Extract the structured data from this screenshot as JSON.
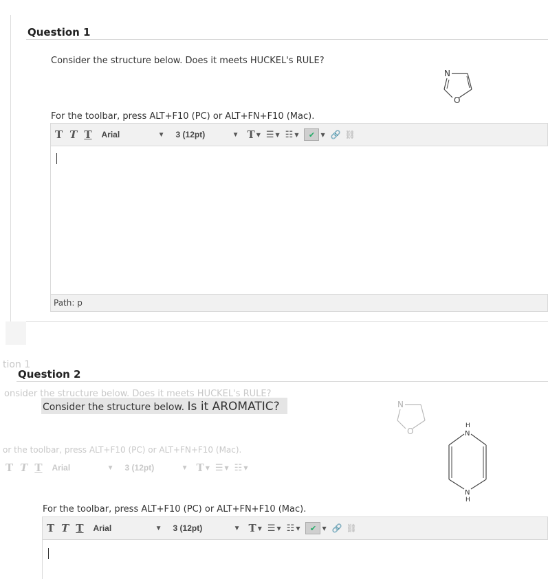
{
  "question1": {
    "title": "Question 1",
    "prompt": "Consider the structure below. Does it meets HUCKEL's RULE?",
    "toolbar_hint": "For the toolbar, press ALT+F10 (PC) or ALT+FN+F10 (Mac).",
    "toolbar": {
      "font": "Arial",
      "size": "3 (12pt)"
    },
    "path_label": "Path: p",
    "molecule": {
      "atom_top": "N",
      "atom_bottom": "O"
    }
  },
  "question2": {
    "ghost_section": "tion 1",
    "title": "Question 2",
    "ghost_prompt": "onsider the structure below. Does it meets HUCKEL's RULE?",
    "prompt_start": "Consider the structure below.",
    "prompt_emph": "Is it AROMATIC?",
    "ghost_hint": "or the toolbar, press ALT+F10 (PC) or ALT+FN+F10 (Mac).",
    "ghost_toolbar": {
      "font": "Arial",
      "size": "3 (12pt)"
    },
    "toolbar_hint": "For the toolbar, press ALT+F10 (PC) or ALT+FN+F10 (Mac).",
    "toolbar": {
      "font": "Arial",
      "size": "3 (12pt)"
    },
    "ghost_molecule": {
      "atom_top": "N",
      "atom_bottom": "O"
    },
    "molecule": {
      "atom_top": "N",
      "atom_top_h": "H",
      "atom_bottom": "N",
      "atom_bottom_h": "H"
    }
  },
  "icons": {
    "bold": "T",
    "italic": "T",
    "underline": "T",
    "text_color": "T",
    "bullets": "☰",
    "numbered": "☷",
    "spell": "✔",
    "link": "🔗",
    "unlink": "⛓"
  }
}
